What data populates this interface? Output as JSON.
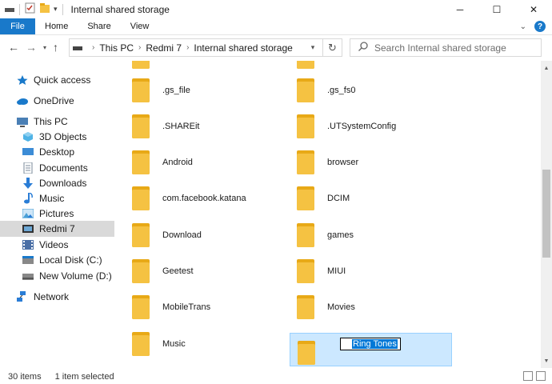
{
  "window": {
    "title": "Internal shared storage",
    "controls": {
      "minimize": "─",
      "maximize": "☐",
      "close": "✕"
    }
  },
  "ribbon": {
    "file": "File",
    "tabs": [
      "Home",
      "Share",
      "View"
    ],
    "expand": "⌄",
    "help": "?"
  },
  "address": {
    "crumbs": [
      "This PC",
      "Redmi 7",
      "Internal shared storage"
    ],
    "search_placeholder": "Search Internal shared storage"
  },
  "navpane": [
    {
      "label": "Quick access",
      "icon": "star-icon",
      "color": "#1979ca"
    },
    {
      "label": "OneDrive",
      "icon": "cloud-icon",
      "color": "#1979ca"
    },
    {
      "label": "This PC",
      "icon": "pc-icon",
      "color": "#4a7fb5"
    },
    {
      "label": "3D Objects",
      "icon": "cube-icon",
      "color": "#4fb3e6"
    },
    {
      "label": "Desktop",
      "icon": "desktop-icon",
      "color": "#3c8cd6"
    },
    {
      "label": "Documents",
      "icon": "document-icon",
      "color": "#7a8a9a"
    },
    {
      "label": "Downloads",
      "icon": "download-icon",
      "color": "#2a7dd6"
    },
    {
      "label": "Music",
      "icon": "music-icon",
      "color": "#2a7dd6"
    },
    {
      "label": "Pictures",
      "icon": "pictures-icon",
      "color": "#4aa0d6"
    },
    {
      "label": "Redmi 7",
      "icon": "phone-icon",
      "color": "#333333",
      "selected": true
    },
    {
      "label": "Videos",
      "icon": "video-icon",
      "color": "#4a6fa6"
    },
    {
      "label": "Local Disk (C:)",
      "icon": "drive-icon",
      "color": "#666666"
    },
    {
      "label": "New Volume (D:)",
      "icon": "drive-icon",
      "color": "#666666"
    },
    {
      "label": "Network",
      "icon": "network-icon",
      "color": "#2a7dd6"
    }
  ],
  "files": [
    {
      "name": ".gs_file"
    },
    {
      "name": ".gs_fs0"
    },
    {
      "name": ".SHAREit"
    },
    {
      "name": ".UTSystemConfig"
    },
    {
      "name": "Android"
    },
    {
      "name": "browser"
    },
    {
      "name": "com.facebook.katana"
    },
    {
      "name": "DCIM"
    },
    {
      "name": "Download"
    },
    {
      "name": "games"
    },
    {
      "name": "Geetest"
    },
    {
      "name": "MIUI"
    },
    {
      "name": "MobileTrans"
    },
    {
      "name": "Movies"
    },
    {
      "name": "Music"
    },
    {
      "name": "Ring Tones",
      "selected": true,
      "renaming": true
    }
  ],
  "status": {
    "count": "30 items",
    "selected": "1 item selected"
  },
  "colors": {
    "folder": "#f5c242",
    "folder_back": "#e8a917",
    "accent": "#1979ca",
    "selection": "#cce8ff"
  }
}
